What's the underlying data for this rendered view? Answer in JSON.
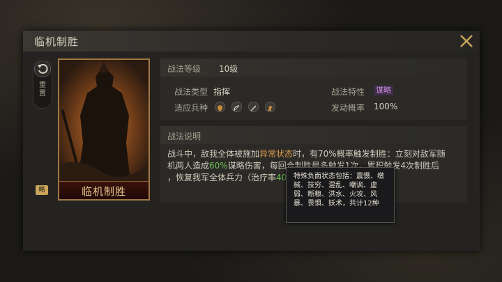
{
  "window": {
    "title": "临机制胜"
  },
  "sidebar": {
    "reset_label": "重置",
    "badge_label": "略"
  },
  "card": {
    "name": "临机制胜"
  },
  "info": {
    "level_label": "战法等级",
    "level_value": "10级",
    "type_label": "战法类型",
    "type_value": "指挥",
    "trait_label": "战法特性",
    "trait_value": "谋略",
    "troops_label": "适应兵种",
    "troop_icons": [
      "shield-icon",
      "bow-icon",
      "spear-icon",
      "horse-icon"
    ],
    "rate_label": "发动概率",
    "rate_value": "100%"
  },
  "description": {
    "header": "战法说明",
    "line1_a": "战斗中，敌我全体被施加",
    "line1_link": "异常状态",
    "line1_b": "时，有70%概率触发制胜：立刻对敌军随",
    "line2_a": "机两人造成",
    "line2_pct": "60%",
    "line2_b": "谋略伤害，每回合制胜最多触发1次，累积触发4次制胜后",
    "line3_a": "，恢复我军全体兵力（治疗率",
    "line3_pct": "40",
    "line3_b": "%）"
  },
  "tooltip": {
    "text": "特殊负面状态包括：震慑、缴械、技穷、混乱、嘲讽、虚弱、断粮、洪水、火攻、风暴、畏惧、妖术，共计12种"
  },
  "colors": {
    "accent": "#c9a45a",
    "highlight": "#d89b4a",
    "green": "#6fbf55",
    "trait": "#c58ad9"
  }
}
